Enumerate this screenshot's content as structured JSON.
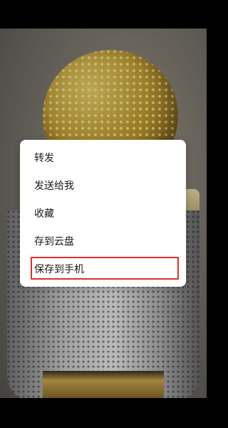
{
  "context_menu": {
    "items": [
      {
        "label": "转发"
      },
      {
        "label": "发送给我"
      },
      {
        "label": "收藏"
      },
      {
        "label": "存到云盘"
      },
      {
        "label": "保存到手机"
      }
    ],
    "highlighted_item": "保存到手机",
    "highlight_color": "#e12d2d"
  },
  "background": {
    "accent_gold": "#c9a131",
    "accent_silver": "#cfcfcf"
  }
}
